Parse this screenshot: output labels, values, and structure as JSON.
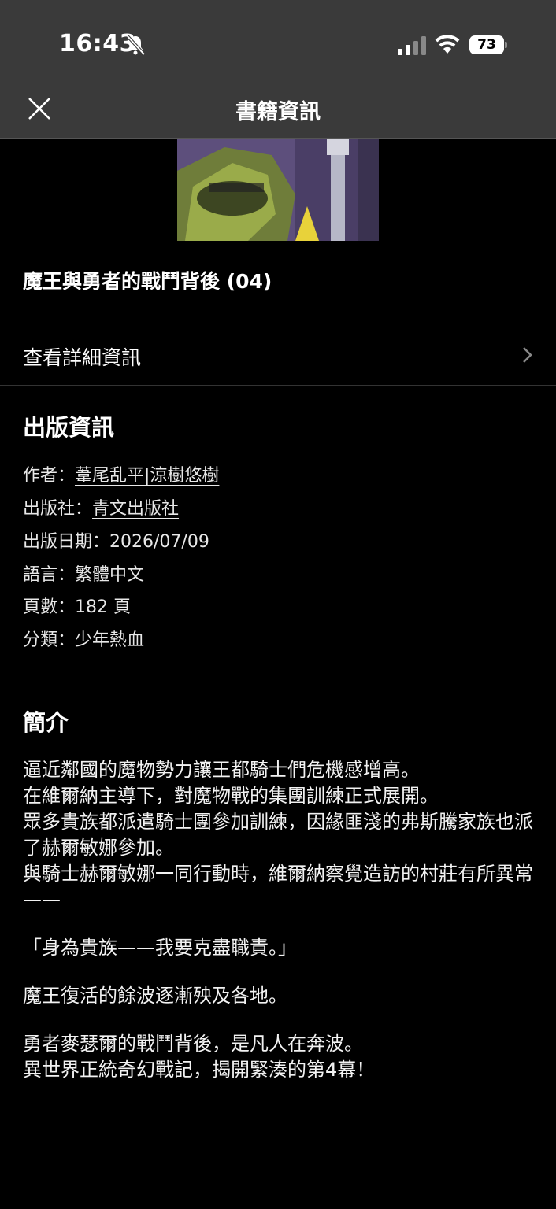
{
  "status_bar": {
    "time": "16:43",
    "battery": "73",
    "icons": [
      "bell-slash-icon",
      "signal-icon",
      "wifi-icon",
      "battery-icon"
    ]
  },
  "nav": {
    "title": "書籍資訊",
    "close_icon": "close-icon"
  },
  "book": {
    "title": "魔王與勇者的戰鬥背後 (04)"
  },
  "detail_row": {
    "label": "查看詳細資訊",
    "icon": "chevron-right-icon"
  },
  "publication": {
    "heading": "出版資訊",
    "author_label": "作者：",
    "author_value": "葦尾乱平|涼樹悠樹",
    "publisher_label": "出版社：",
    "publisher_value": "青文出版社",
    "date_label": "出版日期：",
    "date_value": "2026/07/09",
    "language_label": "語言：",
    "language_value": "繁體中文",
    "pages_label": "頁數：",
    "pages_value": "182 頁",
    "category_label": "分類：",
    "category_value": "少年熱血"
  },
  "intro": {
    "heading": "簡介",
    "paragraphs": [
      "逼近鄰國的魔物勢力讓王都騎士們危機感增高。",
      "在維爾納主導下，對魔物戰的集團訓練正式展開。",
      "眾多貴族都派遣騎士團參加訓練，因緣匪淺的弗斯騰家族也派了赫爾敏娜參加。",
      "與騎士赫爾敏娜一同行動時，維爾納察覺造訪的村莊有所異常——",
      "「身為貴族——我要克盡職責。」",
      "魔王復活的餘波逐漸殃及各地。",
      "勇者麥瑟爾的戰鬥背後，是凡人在奔波。",
      "異世界正統奇幻戰記，揭開緊湊的第4幕！"
    ]
  },
  "colors": {
    "background": "#000000",
    "bar": "#3a3a3a",
    "divider": "#333333",
    "text": "#ffffff"
  }
}
